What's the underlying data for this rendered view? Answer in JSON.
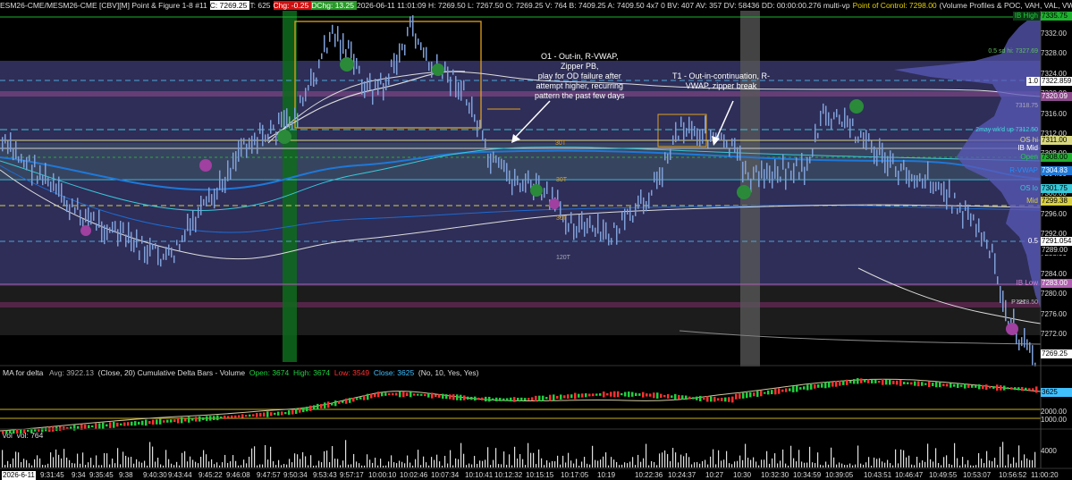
{
  "header": {
    "symbol": "ESM26-CME/MESM26-CME [CBV][M]  Point & Figure 1-8 #11",
    "close_box": "C: 7269.25",
    "trades": "T: 625",
    "chg_box": "Chg: -0.25",
    "dchg_box": "DChg: 13.25",
    "details": "2026-06-11  11:01:09 H: 7269.50  L: 7267.50  O: 7269.25  V: 764  B: 7409.25  A: 7409.50 4x7 0  BV: 407  AV: 357  DV: 58436  DD: 00:00:00.276 multi-vp",
    "poc_text": "Point of Control: 7298.00",
    "studies": "(Volume Profiles & POC, VAH, VAL, VWAP Lines)"
  },
  "price_axis": [
    "7332.00",
    "7328.00",
    "7324.00",
    "7320.00",
    "7316.00",
    "7312.00",
    "7308.00",
    "7304.00",
    "7300.00",
    "7296.00",
    "7292.00",
    "7288.00",
    "7284.00",
    "7280.00",
    "7276.00",
    "7272.00",
    "7268.00"
  ],
  "right_labels": {
    "ib_high": "IB High",
    "sd_hi": "0.5 sd hi: 7327.69",
    "one": "1.0",
    "two_may": "2may wk'd up 7312.50",
    "os_hi": "OS hi",
    "ib_mid": "IB Mid",
    "open": "Open",
    "rvwap": "R-VWAP",
    "os_lo": "OS lo",
    "mid": "Mid",
    "half": "0.5",
    "ib_low": "IB Low",
    "p_set": "P set",
    "p_set_val": "7278.50",
    "p_7318": "7318.75"
  },
  "price_boxes": {
    "ib_high": "7335.75",
    "one": "7322.859",
    "poc": "7320.09",
    "os_hi": "7311.00",
    "open": "7308.00",
    "rvwap": "7304.83",
    "os_lo": "7301.75",
    "mid": "7299.38",
    "half": "7291.054",
    "level": "7289.00",
    "ib_low": "7283.00",
    "last": "7269.25"
  },
  "annotations": {
    "a1": [
      "O1 - Out-in, R-VWAP,",
      "Zipper PB,",
      "play for OD failure after",
      "attempt higher, recurring",
      "pattern the past few days"
    ],
    "a2": [
      "T1 - Out-in-continuation, R-",
      "VWAP, zipper break"
    ],
    "t30a": "30T",
    "t30b": "30T",
    "t30c": "30T",
    "t120": "120T"
  },
  "subchart": {
    "ma_label": "MA for delta",
    "ma_avg": "Avg: 3922.13",
    "ma_params": "(Close, 20)  Cumulative Delta Bars - Volume",
    "open": "Open: 3674",
    "high": "High: 3674",
    "low": "Low: 3549",
    "close": "Close: 3625",
    "params": "(No, 10, Yes, Yes)",
    "value_box": "3625",
    "ref1": "2000.00",
    "ref2": "1000.00",
    "vol_label": "vol",
    "vol_value": "vol: 764",
    "vol_axis": "4000"
  },
  "time_axis": [
    "2026-6-11",
    "9:31:45",
    "9:34",
    "9:35:45",
    "9:38",
    "9:40:30",
    "9:43:44",
    "9:45:22",
    "9:46:08",
    "9:47:57",
    "9:50:34",
    "9:53:43",
    "9:57:17",
    "10:00:10",
    "10:02:46",
    "10:07:34",
    "10:10:41",
    "10:12:32",
    "10:15:15",
    "10:17:05",
    "10:19",
    "10:22:36",
    "10:24:37",
    "10:27",
    "10:30",
    "10:32:30",
    "10:34:59",
    "10:39:05",
    "10:43:51",
    "10:46:47",
    "10:49:55",
    "10:53:07",
    "10:56:52",
    "11:00:20"
  ],
  "colors": {
    "va_band": "#3c3c6a",
    "accent_orange": "#e0a020",
    "vwap_blue": "#1e78d8",
    "green_band": "#0e6b1c",
    "gray_band": "#6a6a6a",
    "pink_band": "#8a3a7a"
  }
}
